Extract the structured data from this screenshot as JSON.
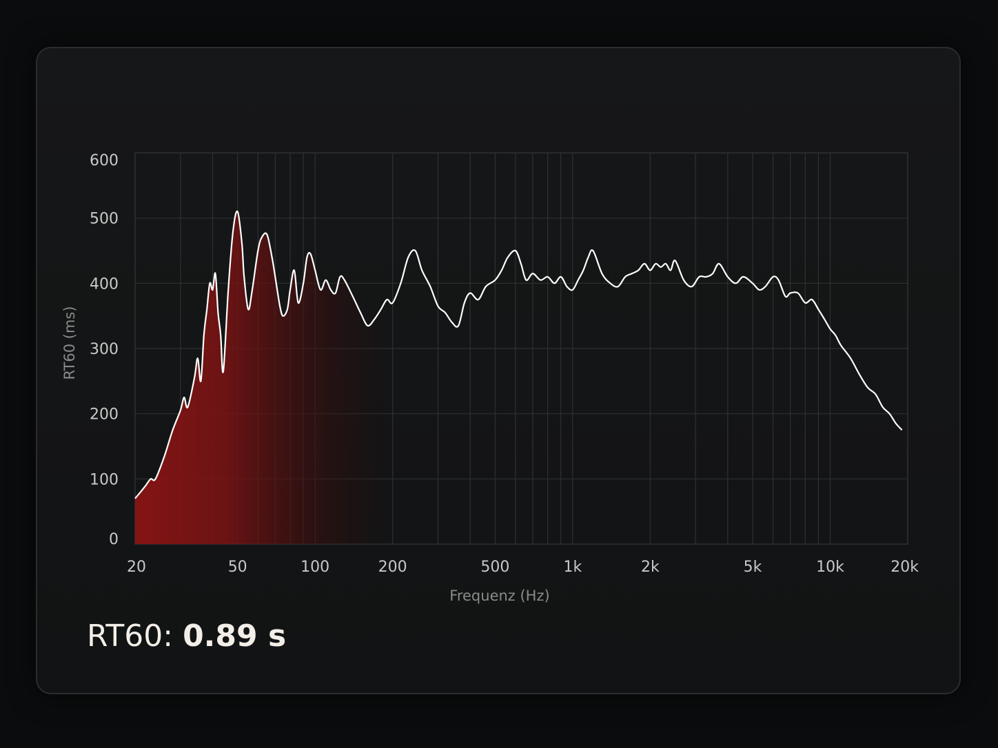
{
  "readout": {
    "label": "RT60:",
    "value": "0.89 s"
  },
  "colors": {
    "line": "#ffffff",
    "fill": "#8b1414",
    "grid": "#2e3032",
    "background": "#131415"
  },
  "chart_data": {
    "type": "area",
    "title": "",
    "xlabel": "Frequenz (Hz)",
    "ylabel": "RT60 (ms)",
    "xscale": "log",
    "xlim": [
      20,
      20000
    ],
    "ylim": [
      0,
      600
    ],
    "grid": true,
    "x_ticks": [
      {
        "value": 20,
        "label": "20"
      },
      {
        "value": 50,
        "label": "50"
      },
      {
        "value": 100,
        "label": "100"
      },
      {
        "value": 200,
        "label": "200"
      },
      {
        "value": 500,
        "label": "500"
      },
      {
        "value": 1000,
        "label": "1k"
      },
      {
        "value": 2000,
        "label": "2k"
      },
      {
        "value": 5000,
        "label": "5k"
      },
      {
        "value": 10000,
        "label": "10k"
      },
      {
        "value": 20000,
        "label": "20k"
      }
    ],
    "y_ticks": [
      {
        "value": 0,
        "label": "0"
      },
      {
        "value": 100,
        "label": "100"
      },
      {
        "value": 200,
        "label": "200"
      },
      {
        "value": 300,
        "label": "300"
      },
      {
        "value": 400,
        "label": "400"
      },
      {
        "value": 500,
        "label": "500"
      },
      {
        "value": 600,
        "label": "600"
      }
    ],
    "series": [
      {
        "x": [
          20,
          21,
          22,
          23,
          24,
          26,
          28,
          30,
          31,
          32,
          34,
          35,
          36,
          37,
          38,
          39,
          40,
          41,
          42,
          43,
          44,
          46,
          48,
          50,
          52,
          53,
          55,
          57,
          60,
          62,
          65,
          68,
          70,
          73,
          75,
          78,
          80,
          83,
          86,
          90,
          93,
          96,
          100,
          105,
          110,
          115,
          120,
          125,
          130,
          140,
          150,
          160,
          170,
          180,
          190,
          200,
          215,
          230,
          245,
          260,
          280,
          300,
          320,
          340,
          360,
          380,
          400,
          430,
          460,
          500,
          530,
          560,
          600,
          630,
          660,
          700,
          750,
          800,
          850,
          900,
          950,
          1000,
          1050,
          1100,
          1150,
          1200,
          1300,
          1400,
          1500,
          1600,
          1700,
          1800,
          1900,
          2000,
          2100,
          2200,
          2300,
          2400,
          2500,
          2700,
          2900,
          3100,
          3300,
          3500,
          3700,
          4000,
          4300,
          4600,
          5000,
          5300,
          5600,
          6000,
          6300,
          6700,
          7000,
          7500,
          8000,
          8500,
          9000,
          9500,
          10000,
          10500,
          11000,
          12000,
          13000,
          14000,
          15000,
          16000,
          17000,
          18000,
          19000
        ],
        "y": [
          70,
          80,
          90,
          100,
          100,
          135,
          175,
          205,
          225,
          210,
          255,
          285,
          250,
          320,
          360,
          400,
          390,
          415,
          355,
          320,
          265,
          390,
          480,
          510,
          460,
          410,
          360,
          390,
          450,
          470,
          475,
          440,
          410,
          365,
          350,
          360,
          390,
          420,
          370,
          400,
          440,
          445,
          420,
          390,
          405,
          390,
          385,
          410,
          405,
          380,
          355,
          335,
          345,
          360,
          375,
          370,
          400,
          440,
          450,
          420,
          395,
          365,
          355,
          340,
          335,
          370,
          385,
          375,
          395,
          405,
          420,
          440,
          450,
          430,
          405,
          415,
          405,
          410,
          400,
          410,
          395,
          390,
          405,
          420,
          440,
          450,
          415,
          400,
          395,
          410,
          415,
          420,
          430,
          420,
          430,
          425,
          430,
          420,
          435,
          405,
          395,
          410,
          410,
          415,
          430,
          410,
          400,
          410,
          400,
          390,
          395,
          410,
          405,
          380,
          385,
          385,
          370,
          375,
          360,
          345,
          330,
          320,
          305,
          285,
          260,
          240,
          230,
          210,
          200,
          185,
          175
        ]
      }
    ]
  }
}
